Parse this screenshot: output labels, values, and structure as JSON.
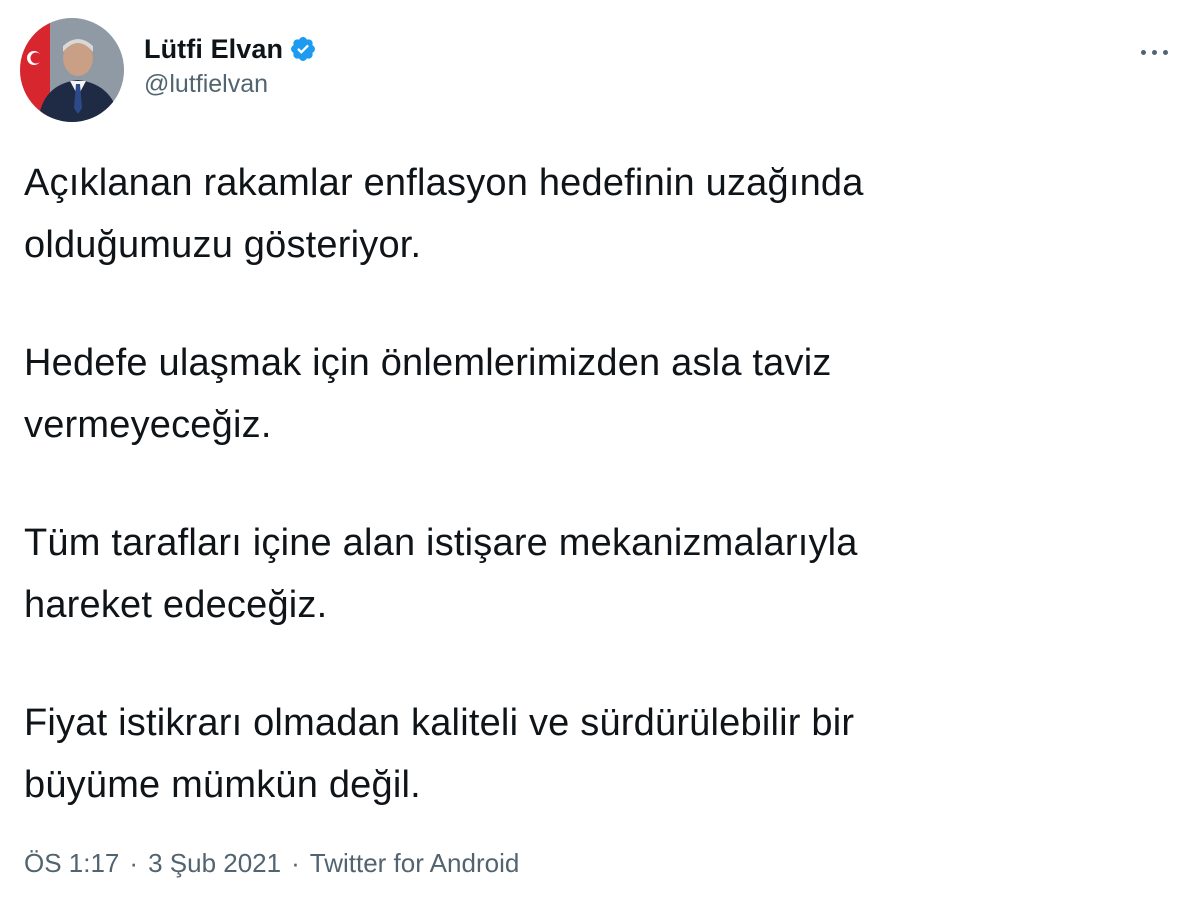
{
  "tweet": {
    "author": {
      "display_name": "Lütfi Elvan",
      "handle": "@lutfielvan",
      "verified": true,
      "verified_icon": "verified-badge-icon",
      "verified_color": "#1d9bf0"
    },
    "more_icon": "more-horizontal-icon",
    "paragraphs": [
      "Açıklanan rakamlar enflasyon hedefinin uzağında\nolduğumuzu gösteriyor.",
      "Hedefe ulaşmak için önlemlerimizden asla taviz\nvermeyeceğiz.",
      "Tüm tarafları içine alan istişare mekanizmalarıyla\nhareket edeceğiz.",
      "Fiyat istikrarı olmadan kaliteli ve sürdürülebilir bir\nbüyüme mümkün değil."
    ],
    "meta": {
      "time": "ÖS 1:17",
      "date": "3 Şub 2021",
      "separator": "·",
      "source": "Twitter for Android"
    }
  }
}
